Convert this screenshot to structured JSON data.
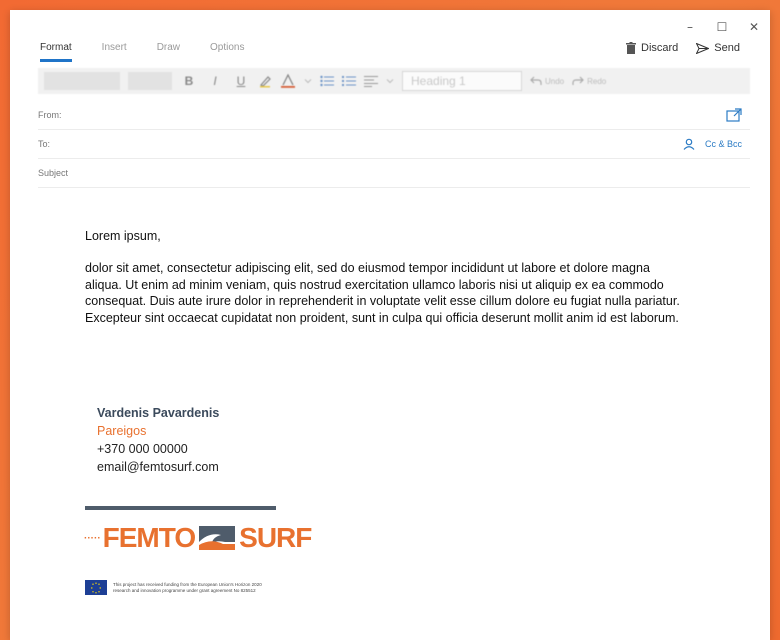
{
  "window": {
    "controls": [
      "–",
      "☐",
      "✕"
    ]
  },
  "tabs": [
    {
      "label": "Format",
      "active": true
    },
    {
      "label": "Insert",
      "active": false
    },
    {
      "label": "Draw",
      "active": false
    },
    {
      "label": "Options",
      "active": false
    }
  ],
  "actions": {
    "discard": {
      "label": "Discard",
      "icon": "trash-icon"
    },
    "send": {
      "label": "Send",
      "icon": "send-icon"
    }
  },
  "ribbon": {
    "bold": "B",
    "italic": "I",
    "underline": "U",
    "style_select": "Heading 1",
    "undo": "Undo",
    "redo": "Redo"
  },
  "fields": {
    "from_label": "From:",
    "to_label": "To:",
    "subject_label": "Subject",
    "cc_bcc": "Cc & Bcc"
  },
  "message": {
    "greeting": "Lorem ipsum,",
    "paragraph": " dolor sit amet, consectetur adipiscing elit, sed do eiusmod tempor incididunt ut labore et dolore magna aliqua. Ut enim ad minim veniam, quis nostrud exercitation ullamco laboris nisi ut aliquip ex ea commodo consequat. Duis aute irure dolor in reprehenderit in voluptate velit esse cillum dolore eu fugiat nulla pariatur. Excepteur sint occaecat cupidatat non proident, sunt in culpa qui officia deserunt mollit anim id est laborum."
  },
  "signature": {
    "name": "Vardenis Pavardenis",
    "title": "Pareigos",
    "phone": "+370 000 00000",
    "email": "email@femtosurf.com"
  },
  "logo": {
    "part1": "FEMTO",
    "part2": "SURF",
    "dash": "·····"
  },
  "eu_notice": {
    "line1": "This project has received funding from the European Union's Horizon 2020",
    "line2": "research and innovation programme under grant agreement No 825512"
  },
  "colors": {
    "accent": "#e8712f",
    "link": "#2b7bc4",
    "tab_underline": "#1f74c8",
    "dark": "#4f5c6b"
  }
}
